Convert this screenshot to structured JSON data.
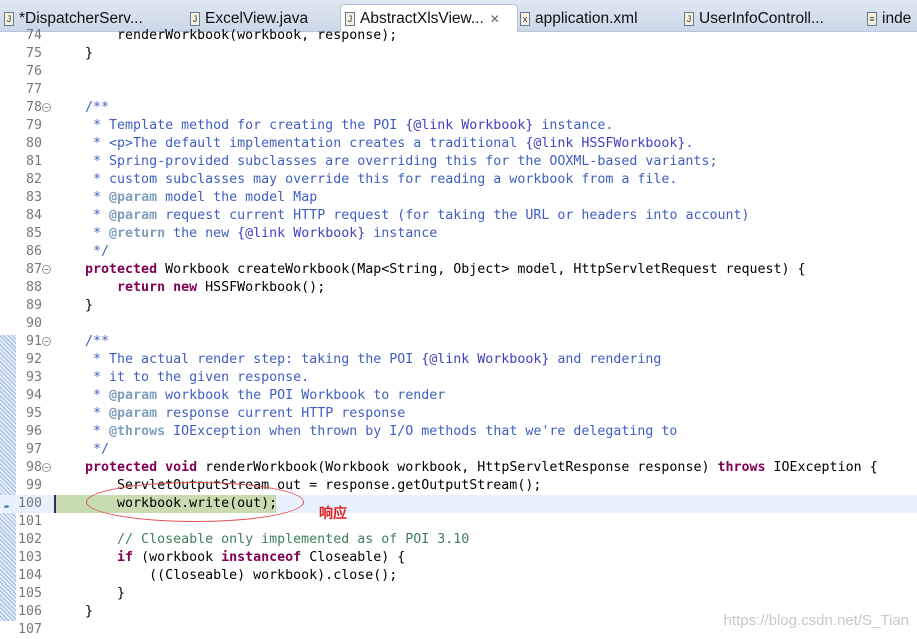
{
  "tabs": [
    {
      "label": "*DispatcherServ...",
      "icon": "java-file-icon",
      "active": false
    },
    {
      "label": "ExcelView.java",
      "icon": "java-file-icon",
      "active": false
    },
    {
      "label": "AbstractXlsView...",
      "icon": "java-file-icon",
      "active": true
    },
    {
      "label": "application.xml",
      "icon": "xml-file-icon",
      "active": false
    },
    {
      "label": "UserInfoControll...",
      "icon": "java-file-icon",
      "active": false
    },
    {
      "label": "inde",
      "icon": "html-file-icon",
      "active": false
    }
  ],
  "annotation": "响应",
  "watermark": "https://blog.csdn.net/S_Tian",
  "current_line": 100,
  "lines": [
    {
      "n": "74",
      "t": [
        [
          "",
          "        renderWorkbook(workbook, response);"
        ]
      ]
    },
    {
      "n": "75",
      "t": [
        [
          "",
          "    }"
        ]
      ]
    },
    {
      "n": "76",
      "t": []
    },
    {
      "n": "77",
      "t": []
    },
    {
      "n": "78",
      "fold": true,
      "t": [
        [
          "jd",
          "    /**"
        ]
      ]
    },
    {
      "n": "79",
      "t": [
        [
          "jd",
          "     * Template method for creating the POI "
        ],
        [
          "jl",
          "{@link Workbook}"
        ],
        [
          "jd",
          " instance."
        ]
      ]
    },
    {
      "n": "80",
      "t": [
        [
          "jd",
          "     * <p>The default implementation creates a traditional "
        ],
        [
          "jl",
          "{@link HSSFWorkbook}"
        ],
        [
          "jd",
          "."
        ]
      ]
    },
    {
      "n": "81",
      "t": [
        [
          "jd",
          "     * Spring-provided subclasses are overriding this for the OOXML-based variants;"
        ]
      ]
    },
    {
      "n": "82",
      "t": [
        [
          "jd",
          "     * custom subclasses may override this for reading a workbook from a file."
        ]
      ]
    },
    {
      "n": "83",
      "t": [
        [
          "jd",
          "     * "
        ],
        [
          "jt",
          "@param"
        ],
        [
          "jd",
          " model the model Map"
        ]
      ]
    },
    {
      "n": "84",
      "t": [
        [
          "jd",
          "     * "
        ],
        [
          "jt",
          "@param"
        ],
        [
          "jd",
          " request current HTTP request (for taking the URL or headers into account)"
        ]
      ]
    },
    {
      "n": "85",
      "t": [
        [
          "jd",
          "     * "
        ],
        [
          "jt",
          "@return"
        ],
        [
          "jd",
          " the new "
        ],
        [
          "jl",
          "{@link Workbook}"
        ],
        [
          "jd",
          " instance"
        ]
      ]
    },
    {
      "n": "86",
      "t": [
        [
          "jd",
          "     */"
        ]
      ]
    },
    {
      "n": "87",
      "fold": true,
      "t": [
        [
          "kw",
          "    protected"
        ],
        [
          "",
          " Workbook createWorkbook(Map<String, Object> model, HttpServletRequest request) {"
        ]
      ]
    },
    {
      "n": "88",
      "t": [
        [
          "kw",
          "        return new"
        ],
        [
          "",
          " HSSFWorkbook();"
        ]
      ]
    },
    {
      "n": "89",
      "t": [
        [
          "",
          "    }"
        ]
      ]
    },
    {
      "n": "90",
      "t": []
    },
    {
      "n": "91",
      "fold": true,
      "t": [
        [
          "jd",
          "    /**"
        ]
      ]
    },
    {
      "n": "92",
      "t": [
        [
          "jd",
          "     * The actual render step: taking the POI "
        ],
        [
          "jl",
          "{@link Workbook}"
        ],
        [
          "jd",
          " and rendering"
        ]
      ]
    },
    {
      "n": "93",
      "t": [
        [
          "jd",
          "     * it to the given response."
        ]
      ]
    },
    {
      "n": "94",
      "t": [
        [
          "jd",
          "     * "
        ],
        [
          "jt",
          "@param"
        ],
        [
          "jd",
          " workbook the POI Workbook to render"
        ]
      ]
    },
    {
      "n": "95",
      "t": [
        [
          "jd",
          "     * "
        ],
        [
          "jt",
          "@param"
        ],
        [
          "jd",
          " response current HTTP response"
        ]
      ]
    },
    {
      "n": "96",
      "t": [
        [
          "jd",
          "     * "
        ],
        [
          "jt",
          "@throws"
        ],
        [
          "jd",
          " IOException when thrown by I/O methods that we're delegating to"
        ]
      ]
    },
    {
      "n": "97",
      "t": [
        [
          "jd",
          "     */"
        ]
      ]
    },
    {
      "n": "98",
      "fold": true,
      "t": [
        [
          "kw",
          "    protected void"
        ],
        [
          "",
          " renderWorkbook(Workbook workbook, HttpServletResponse response) "
        ],
        [
          "kw",
          "throws"
        ],
        [
          "",
          " IOException {"
        ]
      ]
    },
    {
      "n": "99",
      "t": [
        [
          "",
          "        ServletOutputStream out = response.getOutputStream();"
        ]
      ]
    },
    {
      "n": "100",
      "t": [
        [
          "",
          "        workbook.write(out);"
        ]
      ]
    },
    {
      "n": "101",
      "t": []
    },
    {
      "n": "102",
      "t": [
        [
          "cm",
          "        // Closeable only implemented as of POI 3.10"
        ]
      ]
    },
    {
      "n": "103",
      "t": [
        [
          "kw",
          "        if"
        ],
        [
          "",
          " (workbook "
        ],
        [
          "kw",
          "instanceof"
        ],
        [
          "",
          " Closeable) {"
        ]
      ]
    },
    {
      "n": "104",
      "t": [
        [
          "",
          "            ((Closeable) workbook).close();"
        ]
      ]
    },
    {
      "n": "105",
      "t": [
        [
          "",
          "        }"
        ]
      ]
    },
    {
      "n": "106",
      "t": [
        [
          "",
          "    }"
        ]
      ]
    },
    {
      "n": "107",
      "t": []
    }
  ]
}
